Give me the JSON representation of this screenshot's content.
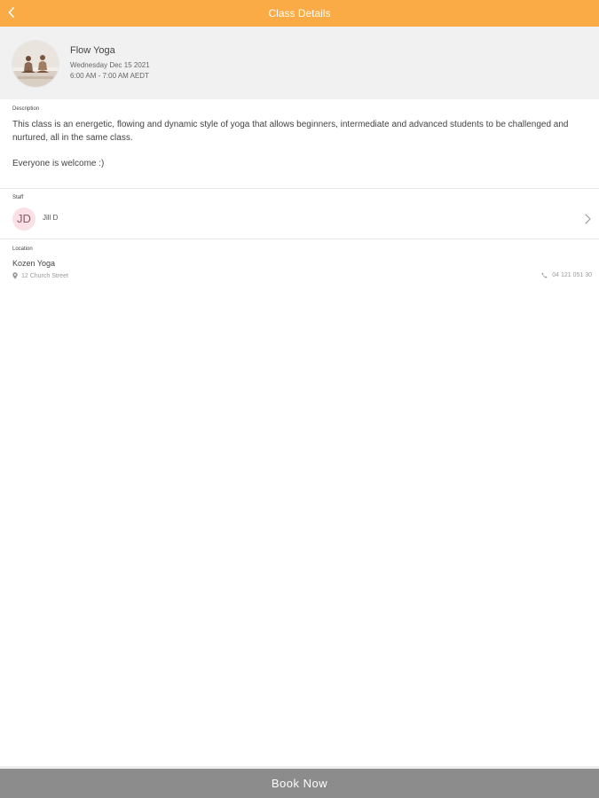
{
  "header": {
    "title": "Class Details",
    "back_icon": "chevron-left-icon"
  },
  "colors": {
    "accent": "#fbab45",
    "header_bg": "#f1f1f1",
    "button_bg": "#8c8c8c",
    "staff_avatar_bg": "#fbe0e6"
  },
  "class": {
    "name": "Flow Yoga",
    "date": "Wednesday Dec 15 2021",
    "time": "6:00 AM - 7:00 AM AEDT"
  },
  "description": {
    "label": "Description",
    "paragraph1": "This class is an energetic, flowing and dynamic style of yoga that allows beginners, intermediate and advanced students to be challenged and nurtured, all in the same class.",
    "paragraph2": "Everyone is welcome :)"
  },
  "staff": {
    "label": "Staff",
    "initials": "JD",
    "name": "Jill D"
  },
  "location": {
    "label": "Location",
    "name": "Kozen Yoga",
    "address": "12 Church Street",
    "phone": "04 121 051 30"
  },
  "footer": {
    "book_label": "Book Now"
  }
}
